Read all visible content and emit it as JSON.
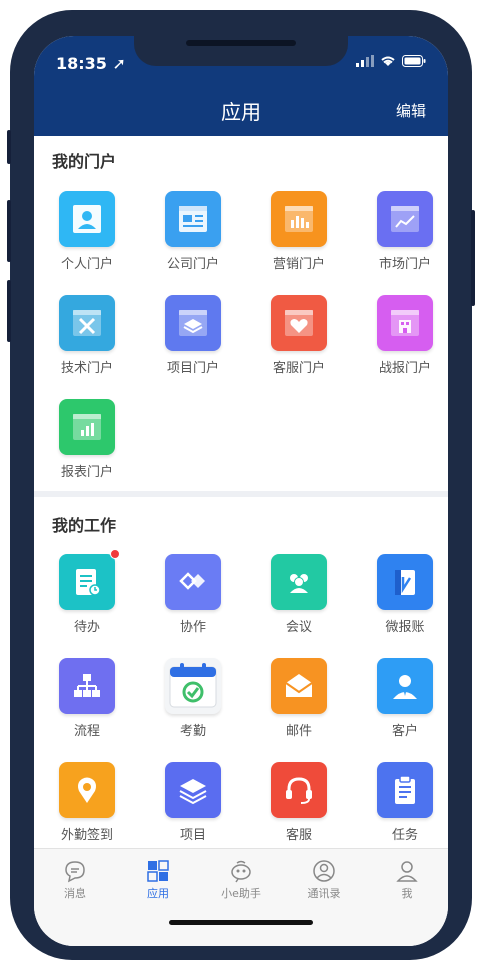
{
  "status": {
    "time": "18:35"
  },
  "header": {
    "title": "应用",
    "edit_label": "编辑"
  },
  "portal": {
    "section_title": "我的门户",
    "items": [
      {
        "label": "个人门户",
        "icon": "person-card-icon",
        "color": "#2fb7f4"
      },
      {
        "label": "公司门户",
        "icon": "company-window-icon",
        "color": "#3aa0f0"
      },
      {
        "label": "营销门户",
        "icon": "bar-chart-icon",
        "color": "#f7931e"
      },
      {
        "label": "市场门户",
        "icon": "line-chart-icon",
        "color": "#6a6ff2"
      },
      {
        "label": "技术门户",
        "icon": "tools-icon",
        "color": "#34a8df"
      },
      {
        "label": "项目门户",
        "icon": "layers-icon",
        "color": "#5f79ef"
      },
      {
        "label": "客服门户",
        "icon": "heart-icon",
        "color": "#f05a43"
      },
      {
        "label": "战报门户",
        "icon": "building-icon",
        "color": "#d65ef0"
      },
      {
        "label": "报表门户",
        "icon": "report-chart-icon",
        "color": "#2dc86c"
      }
    ]
  },
  "work": {
    "section_title": "我的工作",
    "items": [
      {
        "label": "待办",
        "icon": "todo-list-icon",
        "color": "#1cc2c6"
      },
      {
        "label": "协作",
        "icon": "handshake-icon",
        "color": "#6a7cf4"
      },
      {
        "label": "会议",
        "icon": "meeting-people-icon",
        "color": "#22c9a3"
      },
      {
        "label": "微报账",
        "icon": "wallet-icon",
        "color": "#2f82f0"
      },
      {
        "label": "流程",
        "icon": "flowchart-icon",
        "color": "#6f6ff0"
      },
      {
        "label": "考勤",
        "icon": "calendar-check-icon",
        "color": "#3fbf6a"
      },
      {
        "label": "邮件",
        "icon": "mail-icon",
        "color": "#f79322"
      },
      {
        "label": "客户",
        "icon": "customer-icon",
        "color": "#2e9df5"
      },
      {
        "label": "外勤签到",
        "icon": "location-pin-icon",
        "color": "#f7a21e"
      },
      {
        "label": "项目",
        "icon": "stack-icon",
        "color": "#5a6df0"
      },
      {
        "label": "客服",
        "icon": "headset-icon",
        "color": "#ef4b3a"
      },
      {
        "label": "任务",
        "icon": "clipboard-icon",
        "color": "#4d73ef"
      }
    ]
  },
  "tabs": [
    {
      "label": "消息",
      "icon": "chat-bubble-icon"
    },
    {
      "label": "应用",
      "icon": "apps-grid-icon",
      "active": true
    },
    {
      "label": "小e助手",
      "icon": "assistant-bot-icon"
    },
    {
      "label": "通讯录",
      "icon": "contacts-icon"
    },
    {
      "label": "我",
      "icon": "profile-icon"
    }
  ]
}
